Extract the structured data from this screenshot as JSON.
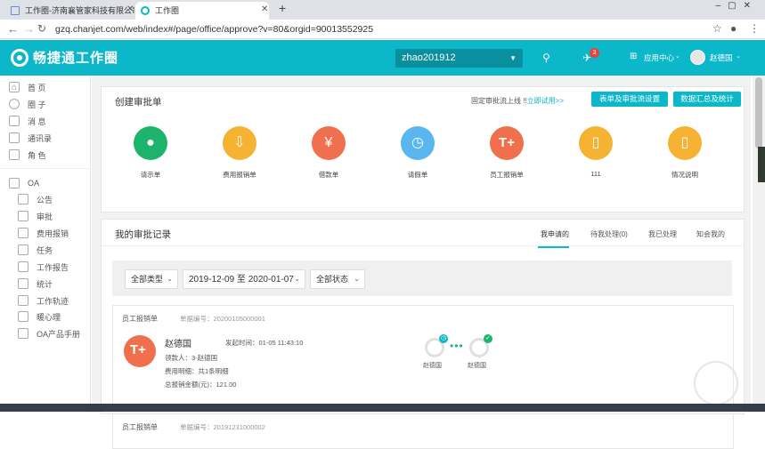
{
  "browser": {
    "tabs": [
      {
        "title": "工作圈-济南襄管家科技有限公司"
      },
      {
        "title": "工作圈"
      }
    ],
    "url": "gzq.chanjet.com/web/index#/page/office/approve?v=80&orgid=90013552925"
  },
  "header": {
    "logo": "畅捷通工作圈",
    "org": "zhao201912",
    "badge_count": "3",
    "app_center": "应用中心",
    "user": "赵德国"
  },
  "sidebar": {
    "top_items": [
      {
        "label": "首 页",
        "icon": "home-icon"
      },
      {
        "label": "圈 子",
        "icon": "circle-icon"
      },
      {
        "label": "消 息",
        "icon": "message-icon"
      },
      {
        "label": "通讯录",
        "icon": "contacts-icon"
      },
      {
        "label": "角 色",
        "icon": "role-icon"
      }
    ],
    "oa_label": "OA",
    "oa_items": [
      {
        "label": "公告",
        "icon": "announcement-icon"
      },
      {
        "label": "审批",
        "icon": "approve-icon"
      },
      {
        "label": "费用报销",
        "icon": "expense-icon"
      },
      {
        "label": "任务",
        "icon": "task-icon"
      },
      {
        "label": "工作报告",
        "icon": "report-icon"
      },
      {
        "label": "统计",
        "icon": "stats-icon"
      },
      {
        "label": "工作轨迹",
        "icon": "track-icon"
      },
      {
        "label": "暖心理",
        "icon": "heart-icon"
      },
      {
        "label": "OA产品手册",
        "icon": "manual-icon"
      }
    ]
  },
  "create": {
    "title": "创建审批单",
    "hint_prefix": "固定审批流上线 !!",
    "hint_link": "立即试用>>",
    "btn_settings": "表单及审批流设置",
    "btn_summary": "数据汇总及统计",
    "items": [
      {
        "label": "请示单",
        "color": "#1db36b",
        "icon": "person-icon"
      },
      {
        "label": "费用报销单",
        "color": "#f6b233",
        "icon": "expense-icon"
      },
      {
        "label": "借款单",
        "color": "#f0704d",
        "icon": "money-bag-icon"
      },
      {
        "label": "请假单",
        "color": "#5ab6ef",
        "icon": "clock-icon"
      },
      {
        "label": "员工报销单",
        "color": "#f0704d",
        "icon": "t-plus-icon"
      },
      {
        "label": "111",
        "color": "#f6b233",
        "icon": "book-icon"
      },
      {
        "label": "情况说明",
        "color": "#f6b233",
        "icon": "book-icon"
      }
    ]
  },
  "records": {
    "title": "我的审批记录",
    "tabs": [
      "我申请的",
      "待我处理(0)",
      "我已处理",
      "知会我的"
    ],
    "filter_type": "全部类型",
    "filter_date": "2019-12-09 至 2020-01-07",
    "filter_status": "全部状态",
    "items": [
      {
        "type": "员工报销单",
        "number": "单据编号：20200105000001",
        "name": "赵德国",
        "time": "发起时间：01-05 11:43:10",
        "payee": "领款人：3-赵德国",
        "detail": "费用明细：共1条明细",
        "amount": "总报销金额(元)：121.00",
        "flow": [
          "赵德国",
          "赵德国"
        ]
      },
      {
        "type": "员工报销单",
        "number": "单据编号：20191231000002"
      }
    ]
  }
}
